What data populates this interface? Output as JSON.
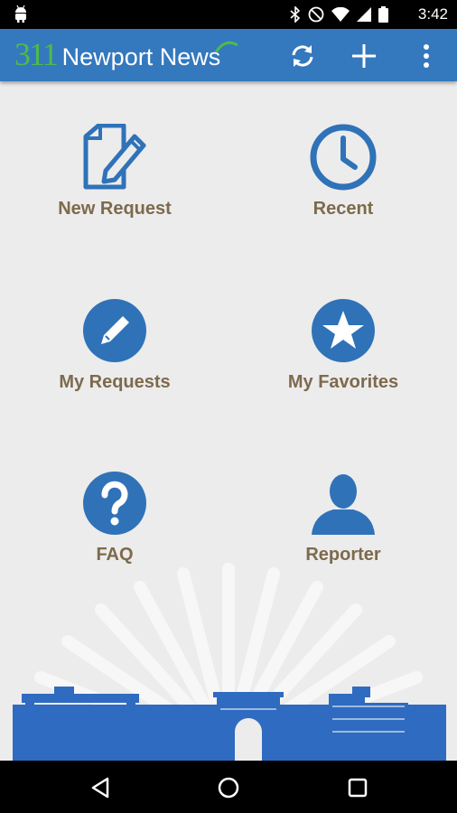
{
  "status_bar": {
    "time": "3:42",
    "icons": [
      "android-icon",
      "bluetooth-icon",
      "do-not-disturb-icon",
      "wifi-icon",
      "signal-icon",
      "battery-icon"
    ]
  },
  "app_bar": {
    "brand_number": "311",
    "brand_name": "Newport News",
    "background": "#3478be",
    "brand_green": "#4dbb4a",
    "actions": [
      "refresh-icon",
      "add-icon",
      "overflow-menu-icon"
    ]
  },
  "menu": {
    "tiles": [
      {
        "label": "New Request",
        "icon": "new-request-icon"
      },
      {
        "label": "Recent",
        "icon": "clock-icon"
      },
      {
        "label": "My Requests",
        "icon": "pencil-icon"
      },
      {
        "label": "My Favorites",
        "icon": "star-icon"
      },
      {
        "label": "FAQ",
        "icon": "question-icon"
      },
      {
        "label": "Reporter",
        "icon": "person-icon"
      }
    ],
    "icon_color": "#2f72b8",
    "label_color": "#7d6a4c"
  },
  "nav_bar": {
    "buttons": [
      "back-icon",
      "home-icon",
      "recents-icon"
    ]
  }
}
